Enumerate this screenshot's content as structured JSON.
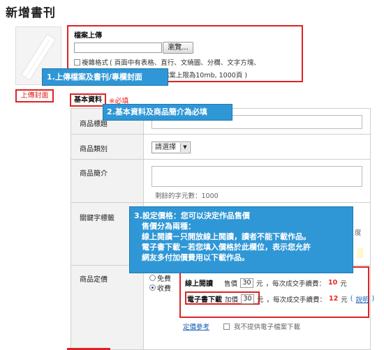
{
  "page": {
    "title": "新增書刊"
  },
  "cover": {
    "button_label": "上傳封面"
  },
  "upload": {
    "title": "檔案上傳",
    "browse_label": "瀏覽...",
    "complex_format_label": "複雜格式",
    "complex_format_desc": "( 頁面中有表格、直行、文繞圖、分欄、文字方塊、",
    "limit_text": "( 檔案上限為10mb, 1000頁 )"
  },
  "callouts": {
    "c1": "1.上傳檔案及書刊/專欄封面",
    "c2": "2.基本資料及商品簡介為必填",
    "c3_lines": [
      "3.設定價格：您可以決定作品售價",
      "　售價分為兩種：",
      "　線上閱讀－只開放線上閱讀，讀者不能下載作品。",
      "　電子書下載－若您填入價格於此欄位，表示您允許",
      "　網友多付加價費用以下載作品。"
    ]
  },
  "basic": {
    "label": "基本資料",
    "required_note": "※必填"
  },
  "form": {
    "product_title_label": "商品標題",
    "category_label": "商品類別",
    "category_select": "請選擇",
    "intro_label": "商品簡介",
    "char_remaining": "剩餘的字元數：1000",
    "keywords_label": "關鍵字標籤",
    "keywords_tail": "度",
    "price_label": "商品定價",
    "free_label": "免費",
    "paid_label": "收費"
  },
  "pricing": {
    "online_label": "線上閱讀",
    "sale_price_label": "售價",
    "online_value": "30",
    "unit": "元",
    "fee_note": "，每次成交手續費：",
    "online_fee": "10",
    "download_label": "電子書下載",
    "add_price_label": "加價",
    "download_value": "30",
    "download_fee": "12",
    "explain_link": "說明",
    "price_ref_link": "定價參考",
    "no_ebook_label": "我不提供電子檔案下載"
  }
}
